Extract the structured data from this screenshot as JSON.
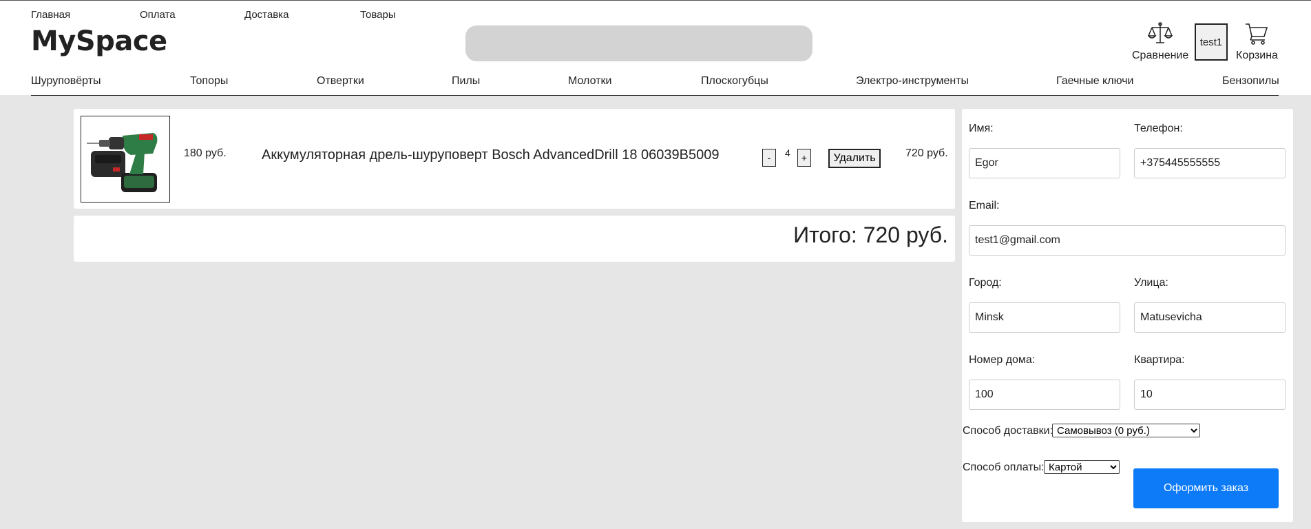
{
  "top_nav": [
    "Главная",
    "Оплата",
    "Доставка",
    "Товары"
  ],
  "logo": "MySpace",
  "header_icons": {
    "compare_label": "Сравнение",
    "user_label": "test1",
    "cart_label": "Корзина"
  },
  "categories": [
    "Шуруповёрты",
    "Топоры",
    "Отвертки",
    "Пилы",
    "Молотки",
    "Плоскогубцы",
    "Электро-инструменты",
    "Гаечные ключи",
    "Бензопилы"
  ],
  "cart": {
    "items": [
      {
        "unit_price": "180 руб.",
        "name": "Аккумуляторная дрель-шуруповерт Bosch AdvancedDrill 18 06039B5009",
        "minus_label": "-",
        "quantity": "4",
        "plus_label": "+",
        "delete_label": "Удалить",
        "line_total": "720 руб."
      }
    ],
    "total": "Итого: 720 руб."
  },
  "form": {
    "name_label": "Имя:",
    "name_value": "Egor",
    "phone_label": "Телефон:",
    "phone_value": "+375445555555",
    "email_label": "Email:",
    "email_value": "test1@gmail.com",
    "city_label": "Город:",
    "city_value": "Minsk",
    "street_label": "Улица:",
    "street_value": "Matusevicha",
    "house_label": "Номер дома:",
    "house_value": "100",
    "apt_label": "Квартира:",
    "apt_value": "10",
    "delivery_label": "Способ доставки:",
    "delivery_selected": "Самовывоз (0 руб.)",
    "payment_label": "Способ оплаты:",
    "payment_selected": "Картой",
    "submit_label": "Оформить заказ"
  },
  "colors": {
    "accent": "#0d7bf7",
    "page_bg": "#e6e6e6",
    "search_bg": "#d3d3d3"
  }
}
